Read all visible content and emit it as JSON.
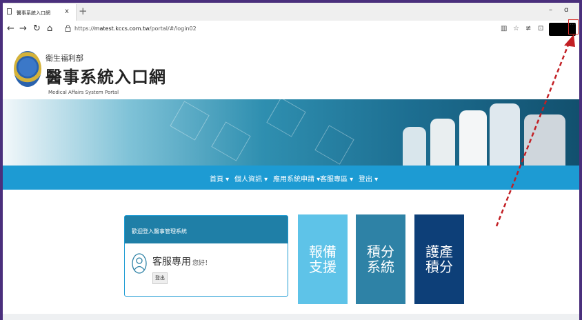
{
  "browser": {
    "tab_title": "醫事系統入口網",
    "tab_close": "x",
    "new_tab": "+",
    "url_prefix": "https://",
    "url_domain": "matest.kccs.com.tw",
    "url_path": "/portal/#/login02",
    "window_minimize": "–",
    "window_restore": "ɑ",
    "more": "···"
  },
  "site": {
    "org_name": "衛生福利部",
    "title": "醫事系統入口網",
    "subtitle": "Medical Affairs System Portal"
  },
  "nav": {
    "items": [
      {
        "label": "首頁 ▾"
      },
      {
        "label": "個人資訊 ▾"
      },
      {
        "label": "應用系統申請 ▾"
      },
      {
        "label": "客服專區 ▾"
      },
      {
        "label": "登出 ▾"
      }
    ]
  },
  "login_card": {
    "header": "歡迎登入醫事管理系統",
    "user_name": "客服專用",
    "greeting": "您好！",
    "logout": "登出"
  },
  "tiles": [
    {
      "label": "報備支援",
      "color": "#5ec3e8"
    },
    {
      "label": "積分系統",
      "color": "#2e82a6"
    },
    {
      "label": "護產積分",
      "color": "#0d3f78"
    }
  ],
  "colors": {
    "accent": "#1d9bd3",
    "annotation_red": "#d9302b",
    "background_purple": "#4a2f7c"
  }
}
